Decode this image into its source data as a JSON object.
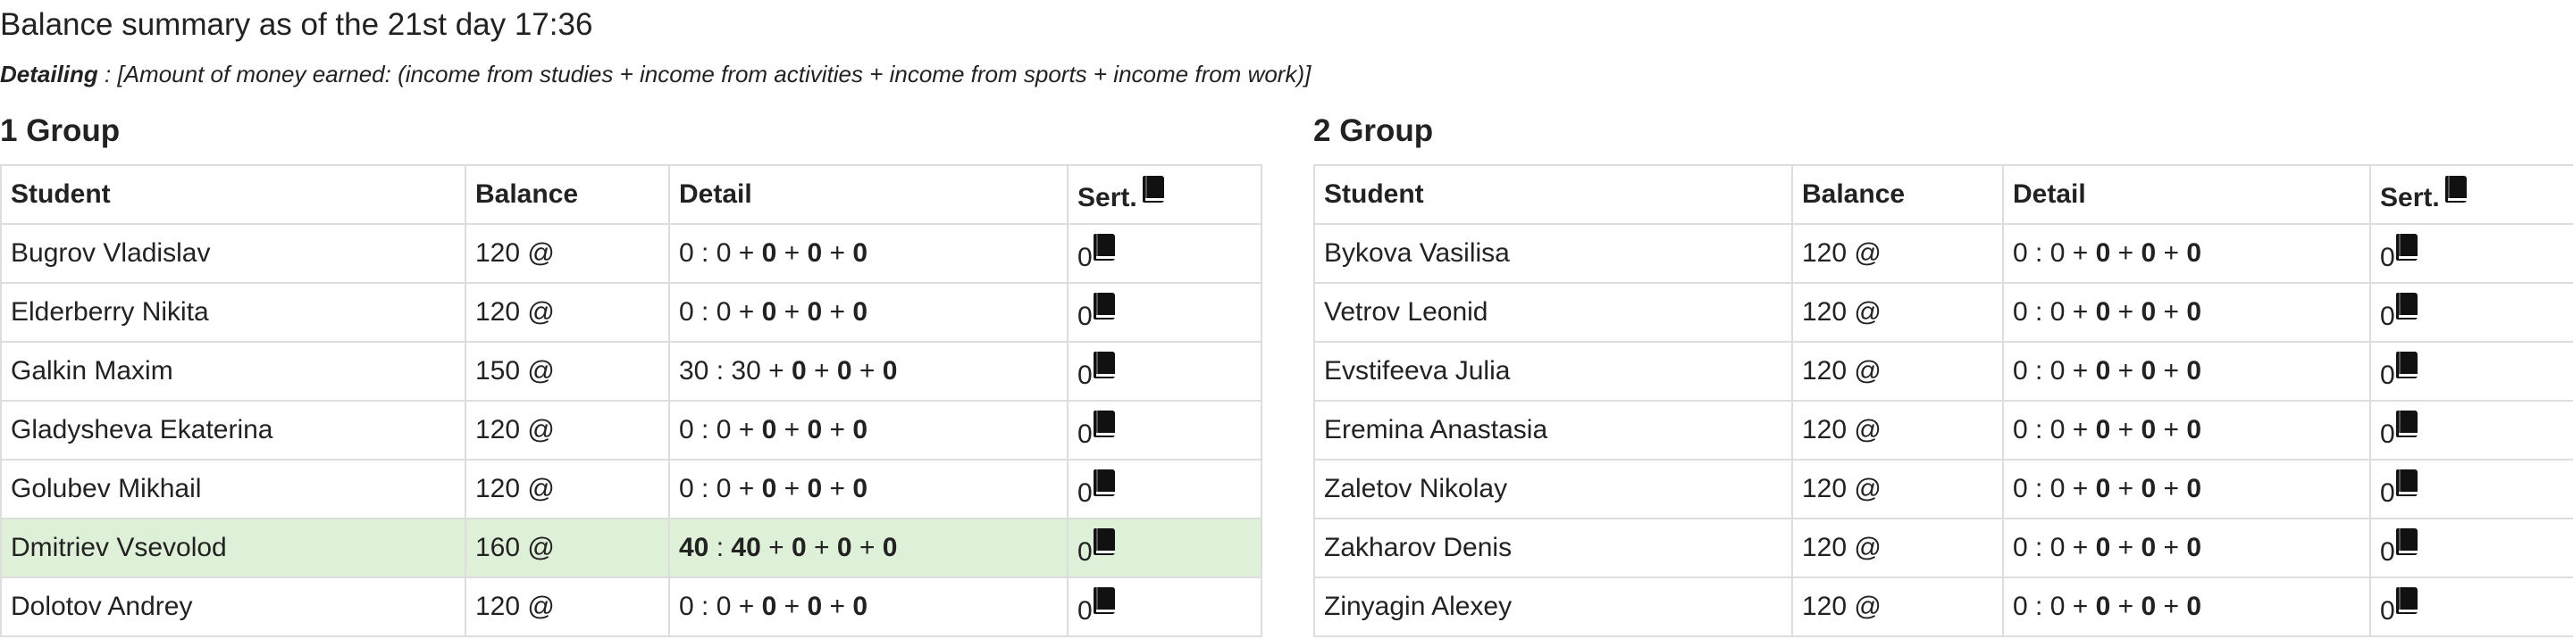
{
  "page": {
    "title": "Balance summary as of the 21st day 17:36",
    "detailing_label": "Detailing",
    "detailing_text": " : [Amount of money earned: (income from studies + income from activities + income from sports + income from work)]"
  },
  "columns": {
    "student": "Student",
    "balance": "Balance",
    "detail": "Detail",
    "sert": "Sert."
  },
  "icons": {
    "sert_icon": "book-icon"
  },
  "colors": {
    "highlight_row": "#dff0d8",
    "border": "#dddddd"
  },
  "groups": [
    {
      "title": "1 Group",
      "rows": [
        {
          "student": "Bugrov Vladislav",
          "balance": "120 @",
          "d1": "0",
          "d2": "0",
          "d3": "0",
          "d4": "0",
          "d5": "0",
          "sert": "0",
          "highlight": false
        },
        {
          "student": "Elderberry Nikita",
          "balance": "120 @",
          "d1": "0",
          "d2": "0",
          "d3": "0",
          "d4": "0",
          "d5": "0",
          "sert": "0",
          "highlight": false
        },
        {
          "student": "Galkin Maxim",
          "balance": "150 @",
          "d1": "30",
          "d2": "30",
          "d3": "0",
          "d4": "0",
          "d5": "0",
          "sert": "0",
          "highlight": false
        },
        {
          "student": "Gladysheva Ekaterina",
          "balance": "120 @",
          "d1": "0",
          "d2": "0",
          "d3": "0",
          "d4": "0",
          "d5": "0",
          "sert": "0",
          "highlight": false
        },
        {
          "student": "Golubev Mikhail",
          "balance": "120 @",
          "d1": "0",
          "d2": "0",
          "d3": "0",
          "d4": "0",
          "d5": "0",
          "sert": "0",
          "highlight": false
        },
        {
          "student": "Dmitriev Vsevolod",
          "balance": "160 @",
          "d1": "40",
          "d2": "40",
          "d3": "0",
          "d4": "0",
          "d5": "0",
          "sert": "0",
          "highlight": true
        },
        {
          "student": "Dolotov Andrey",
          "balance": "120 @",
          "d1": "0",
          "d2": "0",
          "d3": "0",
          "d4": "0",
          "d5": "0",
          "sert": "0",
          "highlight": false
        }
      ]
    },
    {
      "title": "2 Group",
      "rows": [
        {
          "student": "Bykova Vasilisa",
          "balance": "120 @",
          "d1": "0",
          "d2": "0",
          "d3": "0",
          "d4": "0",
          "d5": "0",
          "sert": "0",
          "highlight": false
        },
        {
          "student": "Vetrov Leonid",
          "balance": "120 @",
          "d1": "0",
          "d2": "0",
          "d3": "0",
          "d4": "0",
          "d5": "0",
          "sert": "0",
          "highlight": false
        },
        {
          "student": "Evstifeeva Julia",
          "balance": "120 @",
          "d1": "0",
          "d2": "0",
          "d3": "0",
          "d4": "0",
          "d5": "0",
          "sert": "0",
          "highlight": false
        },
        {
          "student": "Eremina Anastasia",
          "balance": "120 @",
          "d1": "0",
          "d2": "0",
          "d3": "0",
          "d4": "0",
          "d5": "0",
          "sert": "0",
          "highlight": false
        },
        {
          "student": "Zaletov Nikolay",
          "balance": "120 @",
          "d1": "0",
          "d2": "0",
          "d3": "0",
          "d4": "0",
          "d5": "0",
          "sert": "0",
          "highlight": false
        },
        {
          "student": "Zakharov Denis",
          "balance": "120 @",
          "d1": "0",
          "d2": "0",
          "d3": "0",
          "d4": "0",
          "d5": "0",
          "sert": "0",
          "highlight": false
        },
        {
          "student": "Zinyagin Alexey",
          "balance": "120 @",
          "d1": "0",
          "d2": "0",
          "d3": "0",
          "d4": "0",
          "d5": "0",
          "sert": "0",
          "highlight": false
        }
      ]
    }
  ]
}
